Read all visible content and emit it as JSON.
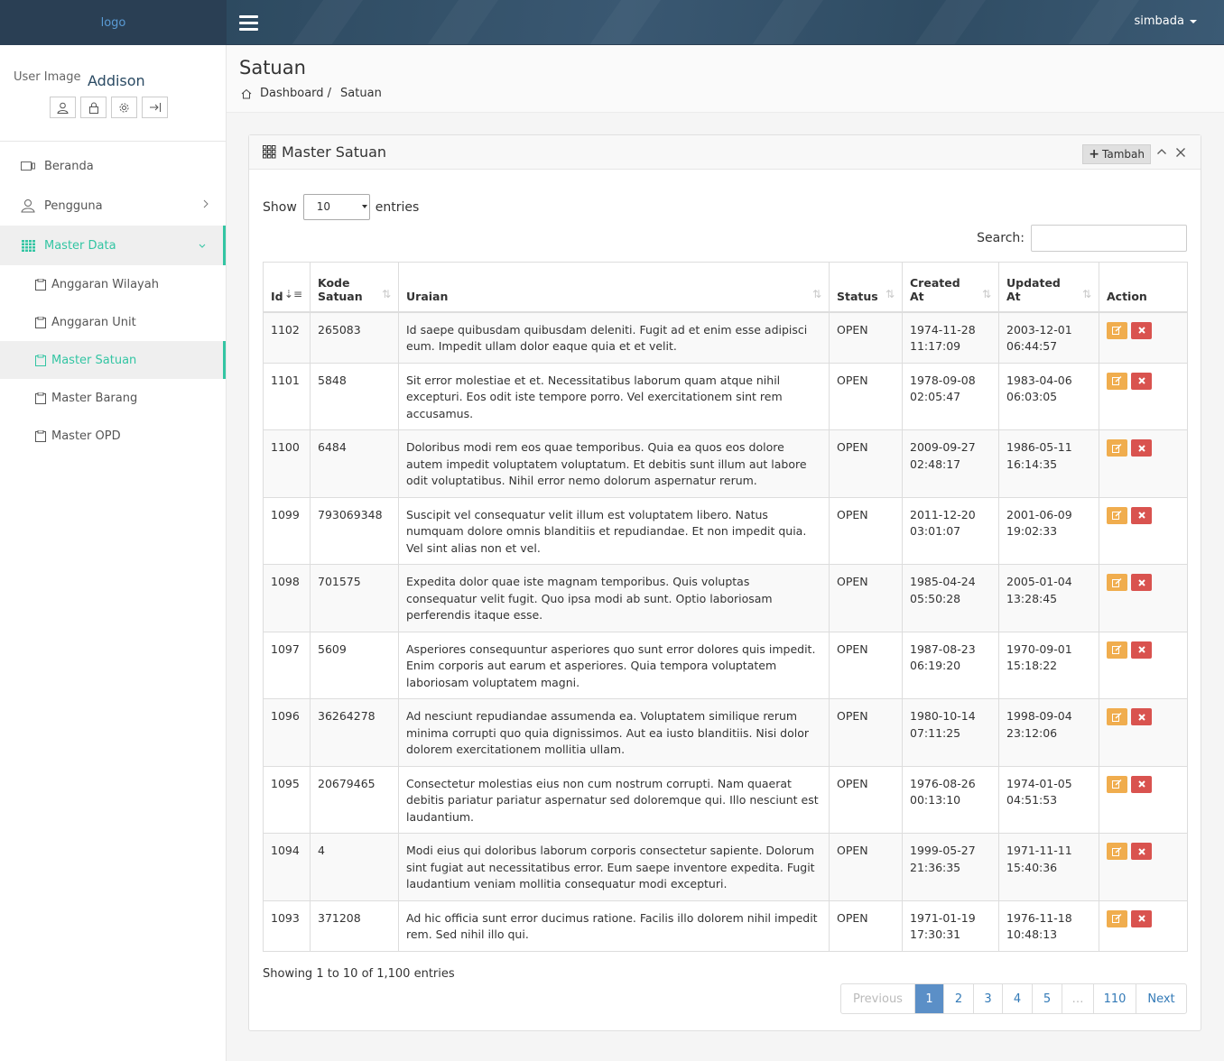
{
  "brand": {
    "logo": "logo"
  },
  "navbar": {
    "user": "simbada"
  },
  "profile": {
    "image_alt": "User Image",
    "name": "Addison"
  },
  "sidebar": {
    "items": [
      {
        "label": "Beranda"
      },
      {
        "label": "Pengguna"
      },
      {
        "label": "Master Data"
      }
    ],
    "subitems": [
      {
        "label": "Anggaran Wilayah"
      },
      {
        "label": "Anggaran Unit"
      },
      {
        "label": "Master Satuan"
      },
      {
        "label": "Master Barang"
      },
      {
        "label": "Master OPD"
      }
    ]
  },
  "page": {
    "title": "Satuan",
    "breadcrumb": {
      "home": "Dashboard /",
      "current": "Satuan"
    }
  },
  "panel": {
    "title": "Master Satuan",
    "add_label": "Tambah",
    "show_label": "Show",
    "entries_label": "entries",
    "page_length": "10",
    "search_label": "Search:",
    "search_value": ""
  },
  "table": {
    "headers": {
      "id": "Id",
      "kode1": "Kode",
      "kode2": "Satuan",
      "uraian": "Uraian",
      "status": "Status",
      "created1": "Created",
      "created2": "At",
      "updated1": "Updated",
      "updated2": "At",
      "action": "Action"
    },
    "rows": [
      {
        "id": "1102",
        "kode": "265083",
        "uraian": "Id saepe quibusdam quibusdam deleniti. Fugit ad et enim esse adipisci eum. Impedit ullam dolor eaque quia et et velit.",
        "status": "OPEN",
        "created_date": "1974-11-28",
        "created_time": "11:17:09",
        "updated_date": "2003-12-01",
        "updated_time": "06:44:57"
      },
      {
        "id": "1101",
        "kode": "5848",
        "uraian": "Sit error molestiae et et. Necessitatibus laborum quam atque nihil excepturi. Eos odit iste tempore porro. Vel exercitationem sint rem accusamus.",
        "status": "OPEN",
        "created_date": "1978-09-08",
        "created_time": "02:05:47",
        "updated_date": "1983-04-06",
        "updated_time": "06:03:05"
      },
      {
        "id": "1100",
        "kode": "6484",
        "uraian": "Doloribus modi rem eos quae temporibus. Quia ea quos eos dolore autem impedit voluptatem voluptatum. Et debitis sunt illum aut labore odit voluptatibus. Nihil error nemo dolorum aspernatur rerum.",
        "status": "OPEN",
        "created_date": "2009-09-27",
        "created_time": "02:48:17",
        "updated_date": "1986-05-11",
        "updated_time": "16:14:35"
      },
      {
        "id": "1099",
        "kode": "793069348",
        "uraian": "Suscipit vel consequatur velit illum est voluptatem libero. Natus numquam dolore omnis blanditiis et repudiandae. Et non impedit quia. Vel sint alias non et vel.",
        "status": "OPEN",
        "created_date": "2011-12-20",
        "created_time": "03:01:07",
        "updated_date": "2001-06-09",
        "updated_time": "19:02:33"
      },
      {
        "id": "1098",
        "kode": "701575",
        "uraian": "Expedita dolor quae iste magnam temporibus. Quis voluptas consequatur velit fugit. Quo ipsa modi ab sunt. Optio laboriosam perferendis itaque esse.",
        "status": "OPEN",
        "created_date": "1985-04-24",
        "created_time": "05:50:28",
        "updated_date": "2005-01-04",
        "updated_time": "13:28:45"
      },
      {
        "id": "1097",
        "kode": "5609",
        "uraian": "Asperiores consequuntur asperiores quo sunt error dolores quis impedit. Enim corporis aut earum et asperiores. Quia tempora voluptatem laboriosam voluptatem magni.",
        "status": "OPEN",
        "created_date": "1987-08-23",
        "created_time": "06:19:20",
        "updated_date": "1970-09-01",
        "updated_time": "15:18:22"
      },
      {
        "id": "1096",
        "kode": "36264278",
        "uraian": "Ad nesciunt repudiandae assumenda ea. Voluptatem similique rerum minima corrupti quo quia dignissimos. Aut ea iusto blanditiis. Nisi dolor dolorem exercitationem mollitia ullam.",
        "status": "OPEN",
        "created_date": "1980-10-14",
        "created_time": "07:11:25",
        "updated_date": "1998-09-04",
        "updated_time": "23:12:06"
      },
      {
        "id": "1095",
        "kode": "20679465",
        "uraian": "Consectetur molestias eius non cum nostrum corrupti. Nam quaerat debitis pariatur pariatur aspernatur sed doloremque qui. Illo nesciunt est laudantium.",
        "status": "OPEN",
        "created_date": "1976-08-26",
        "created_time": "00:13:10",
        "updated_date": "1974-01-05",
        "updated_time": "04:51:53"
      },
      {
        "id": "1094",
        "kode": "4",
        "uraian": "Modi eius qui doloribus laborum corporis consectetur sapiente. Dolorum sint fugiat aut necessitatibus error. Eum saepe inventore expedita. Fugit laudantium veniam mollitia consequatur modi excepturi.",
        "status": "OPEN",
        "created_date": "1999-05-27",
        "created_time": "21:36:35",
        "updated_date": "1971-11-11",
        "updated_time": "15:40:36"
      },
      {
        "id": "1093",
        "kode": "371208",
        "uraian": "Ad hic officia sunt error ducimus ratione. Facilis illo dolorem nihil impedit rem. Sed nihil illo qui.",
        "status": "OPEN",
        "created_date": "1971-01-19",
        "created_time": "17:30:31",
        "updated_date": "1976-11-18",
        "updated_time": "10:48:13"
      }
    ]
  },
  "footer": {
    "info": "Showing 1 to 10 of 1,100 entries",
    "pagination": [
      "Previous",
      "1",
      "2",
      "3",
      "4",
      "5",
      "…",
      "110",
      "Next"
    ],
    "current_page": "1"
  },
  "colors": {
    "accent": "#33c5a3",
    "navbar": "#2d4a60",
    "edit_button": "#f0ad4e",
    "delete_button": "#d9534f",
    "page_active": "#5b8fc7"
  },
  "icons": [
    "menu-icon",
    "user-icon",
    "lock-icon",
    "gear-icon",
    "logout-icon",
    "monitor-icon",
    "users-icon",
    "grid-icon",
    "clipboard-icon",
    "home-icon",
    "plus-icon",
    "chevron-up-icon",
    "close-icon",
    "edit-icon",
    "delete-icon",
    "sort-icon"
  ]
}
